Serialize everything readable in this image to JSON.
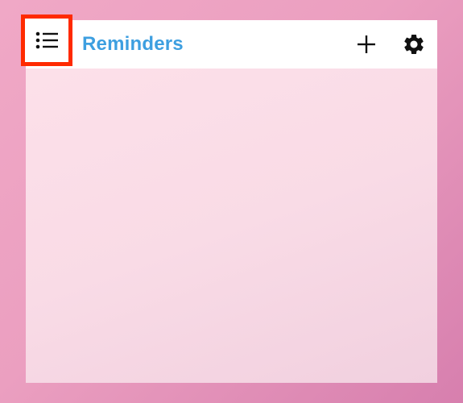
{
  "header": {
    "title": "Reminders",
    "menu_icon": "list-icon",
    "add_icon": "plus-icon",
    "settings_icon": "gear-icon"
  },
  "colors": {
    "title": "#3d9fe0",
    "highlight_border": "#ff2a00",
    "background": "#eb9fc0",
    "panel": "#fbdde8"
  }
}
